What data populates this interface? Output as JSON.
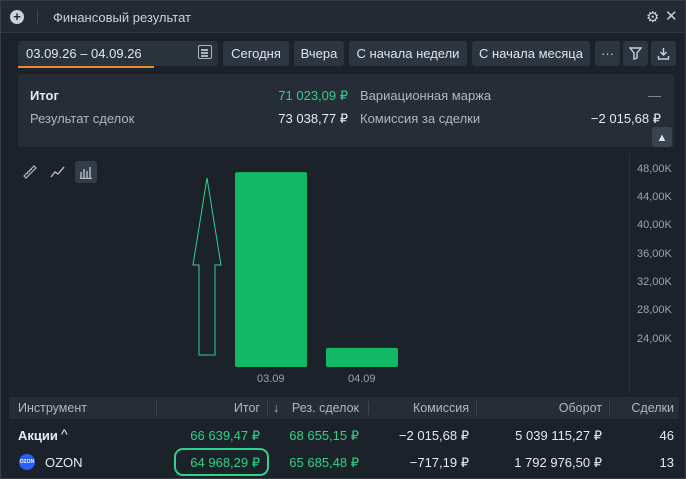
{
  "window": {
    "title": "Финансовый результат",
    "add_icon": "plus-circle-icon",
    "settings_icon": "gear-icon",
    "close_icon": "close-icon"
  },
  "toolbar": {
    "date_range": "03.09.26 – 04.09.26",
    "calendar_icon": "calendar-icon",
    "buttons": [
      "Сегодня",
      "Вчера",
      "С начала недели",
      "С начала месяца"
    ],
    "more_label": "···",
    "filter_icon": "filter-icon",
    "export_icon": "download-icon"
  },
  "summary": {
    "total_label": "Итог",
    "total_value": "71 023,09 ₽",
    "trades_label": "Результат сделок",
    "trades_value": "73 038,77 ₽",
    "margin_label": "Вариационная маржа",
    "margin_value": "—",
    "commission_label": "Комиссия за сделки",
    "commission_value": "−2 015,68 ₽",
    "collapse_icon": "chevron-up-icon"
  },
  "chart_tools": [
    "ruler-icon",
    "line-chart-icon",
    "bar-chart-icon"
  ],
  "chart_data": {
    "type": "bar",
    "categories": [
      "03.09",
      "04.09"
    ],
    "values": [
      47500,
      22700
    ],
    "yticks": [
      "48,00K",
      "44,00K",
      "40,00K",
      "36,00K",
      "32,00K",
      "28,00K",
      "24,00K"
    ],
    "ylim": [
      20000,
      48500
    ],
    "bar_color": "#12b866"
  },
  "table": {
    "headers": {
      "instrument": "Инструмент",
      "total": "Итог",
      "trades": "Рез. сделок",
      "commission": "Комиссия",
      "turnover": "Оборот",
      "deals": "Сделки",
      "sort_icon": "↓"
    },
    "rows": [
      {
        "instrument": "Акции",
        "expand": "^",
        "total": "66 639,47 ₽",
        "trades": "68 655,15 ₽",
        "commission": "−2 015,68 ₽",
        "turnover": "5 039 115,27 ₽",
        "deals": "46"
      },
      {
        "instrument": "OZON",
        "logo": "ozon-logo-icon",
        "logo_text": "OZON",
        "total": "64 968,29 ₽",
        "trades": "65 685,48 ₽",
        "commission": "−717,19 ₽",
        "turnover": "1 792 976,50 ₽",
        "deals": "13"
      }
    ]
  }
}
